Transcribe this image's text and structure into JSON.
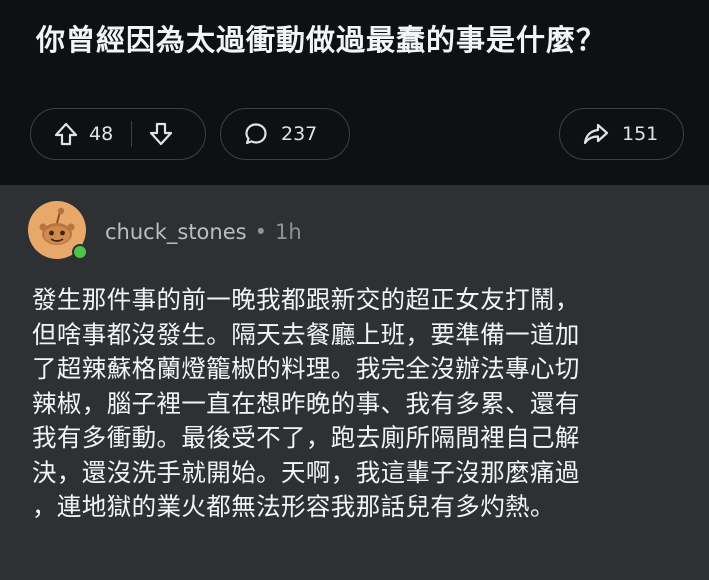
{
  "post": {
    "title": "你曾經因為太過衝動做過最蠢的事是什麼？",
    "actions": {
      "upvote_count": "48",
      "comment_count": "237",
      "share_count": "151"
    }
  },
  "comment": {
    "username": "chuck_stones",
    "separator": "•",
    "time": "1h",
    "online": true,
    "lines": [
      "發生那件事的前一晚我都跟新交的超正女友打鬧，",
      "但啥事都沒發生。隔天去餐廳上班，要準備一道加",
      "了超辣蘇格蘭燈籠椒的料理。我完全沒辦法專心切",
      "辣椒，腦子裡一直在想昨晚的事、我有多累、還有",
      "我有多衝動。最後受不了，跑去廁所隔間裡自己解",
      "決，還沒洗手就開始。天啊，我這輩子沒那麼痛過",
      "，連地獄的業火都無法形容我那話兒有多灼熱。"
    ]
  },
  "colors": {
    "header_bg": "#0e1113",
    "comment_bg": "#2e3133",
    "pill_border": "#3a4147",
    "online": "#4ec24b",
    "avatar_bg": "#e8a86a"
  },
  "icons": {
    "upvote": "arrow-up-outline-icon",
    "downvote": "arrow-down-outline-icon",
    "comment": "speech-bubble-icon",
    "share": "share-arrow-icon",
    "avatar": "reddit-snoo-avatar"
  }
}
